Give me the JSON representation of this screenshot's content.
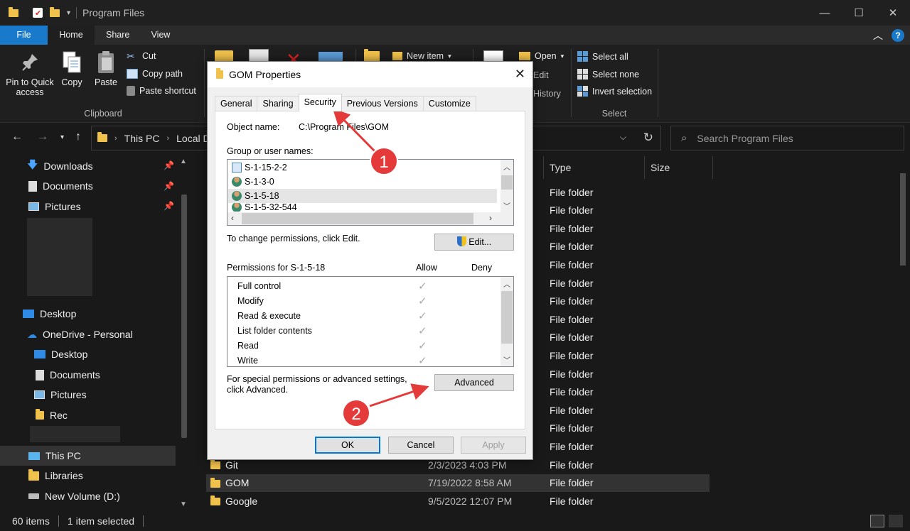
{
  "window": {
    "title": "Program Files",
    "minimize": "—",
    "maximize": "☐",
    "close": "✕"
  },
  "ribbon": {
    "tabs": [
      "File",
      "Home",
      "Share",
      "View"
    ],
    "clipboard": {
      "pin_label": "Pin to Quick access",
      "copy_label": "Copy",
      "paste_label": "Paste",
      "cut_label": "Cut",
      "copy_path_label": "Copy path",
      "paste_shortcut_label": "Paste shortcut",
      "group_label": "Clipboard"
    },
    "new_item_label": "New item",
    "open_label": "Open",
    "edit_label": "Edit",
    "history_label": "History",
    "select": {
      "select_all": "Select all",
      "select_none": "Select none",
      "invert": "Invert selection",
      "group_label": "Select"
    }
  },
  "address": {
    "crumbs": [
      "This PC",
      "Local D"
    ],
    "search_placeholder": "Search Program Files"
  },
  "sidebar": {
    "items": [
      {
        "label": "Downloads",
        "icon": "download-icon",
        "pinned": true
      },
      {
        "label": "Documents",
        "icon": "documents-icon",
        "pinned": true
      },
      {
        "label": "Pictures",
        "icon": "pictures-icon",
        "pinned": true
      },
      {
        "label": "Desktop",
        "icon": "desktop-icon"
      },
      {
        "label": "OneDrive - Personal",
        "icon": "cloud-icon"
      },
      {
        "label": "Desktop",
        "icon": "desktop-icon"
      },
      {
        "label": "Documents",
        "icon": "documents-icon"
      },
      {
        "label": "Pictures",
        "icon": "pictures-icon"
      },
      {
        "label": "Rec",
        "icon": "folder-icon"
      },
      {
        "label": "This PC",
        "icon": "pc-icon"
      },
      {
        "label": "Libraries",
        "icon": "libraries-icon"
      },
      {
        "label": "New Volume (D:)",
        "icon": "drive-icon"
      }
    ]
  },
  "filelist": {
    "columns": [
      "Type",
      "Size"
    ],
    "rows": [
      {
        "name": "",
        "date": "",
        "type": "File folder"
      },
      {
        "name": "",
        "date": "",
        "type": "File folder"
      },
      {
        "name": "",
        "date": "",
        "type": "File folder"
      },
      {
        "name": "",
        "date": "",
        "type": "File folder"
      },
      {
        "name": "",
        "date": "",
        "type": "File folder"
      },
      {
        "name": "",
        "date": "",
        "type": "File folder"
      },
      {
        "name": "",
        "date": "",
        "type": "File folder"
      },
      {
        "name": "",
        "date": "",
        "type": "File folder"
      },
      {
        "name": "",
        "date": "",
        "type": "File folder"
      },
      {
        "name": "",
        "date": "",
        "type": "File folder"
      },
      {
        "name": "",
        "date": "",
        "type": "File folder"
      },
      {
        "name": "",
        "date": "",
        "type": "File folder"
      },
      {
        "name": "",
        "date": "",
        "type": "File folder"
      },
      {
        "name": "",
        "date": "",
        "type": "File folder"
      },
      {
        "name": "",
        "date": "",
        "type": "File folder"
      },
      {
        "name": "Git",
        "date": "2/3/2023 4:03 PM",
        "type": "File folder"
      },
      {
        "name": "GOM",
        "date": "7/19/2022 8:58 AM",
        "type": "File folder"
      },
      {
        "name": "Google",
        "date": "9/5/2022 12:07 PM",
        "type": "File folder"
      }
    ]
  },
  "status": {
    "count": "60 items",
    "selected": "1 item selected"
  },
  "dialog": {
    "title": "GOM Properties",
    "tabs": [
      "General",
      "Sharing",
      "Security",
      "Previous Versions",
      "Customize"
    ],
    "object_name_label": "Object name:",
    "object_name_value": "C:\\Program Files\\GOM",
    "group_label": "Group or user names:",
    "users": [
      "S-1-15-2-2",
      "S-1-3-0",
      "S-1-5-18",
      "S-1-5-32-544"
    ],
    "change_text": "To change permissions, click Edit.",
    "edit_button": "Edit...",
    "permissions_label": "Permissions for S-1-5-18",
    "allow_label": "Allow",
    "deny_label": "Deny",
    "permissions": [
      "Full control",
      "Modify",
      "Read & execute",
      "List folder contents",
      "Read",
      "Write"
    ],
    "advanced_text_1": "For special permissions or advanced settings,",
    "advanced_text_2": "click Advanced.",
    "advanced_button": "Advanced",
    "ok": "OK",
    "cancel": "Cancel",
    "apply": "Apply"
  },
  "annotations": {
    "badge1": "1",
    "badge2": "2",
    "color": "#e53a3a"
  }
}
